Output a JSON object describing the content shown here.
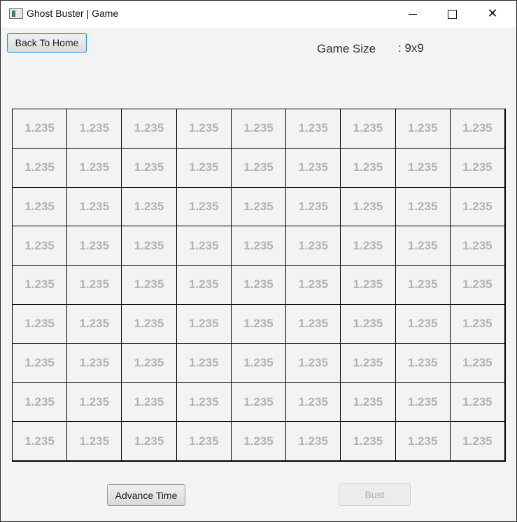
{
  "window": {
    "title": "Ghost Buster | Game",
    "icon": "app-window-icon"
  },
  "controls": {
    "minimize": "minimize-icon",
    "maximize": "maximize-icon",
    "close": "close-icon"
  },
  "header": {
    "back_label": "Back To Home",
    "game_size_label": "Game Size",
    "game_size_value": ": 9x9"
  },
  "board": {
    "rows": 9,
    "cols": 9,
    "cells": [
      [
        "1.235",
        "1.235",
        "1.235",
        "1.235",
        "1.235",
        "1.235",
        "1.235",
        "1.235",
        "1.235"
      ],
      [
        "1.235",
        "1.235",
        "1.235",
        "1.235",
        "1.235",
        "1.235",
        "1.235",
        "1.235",
        "1.235"
      ],
      [
        "1.235",
        "1.235",
        "1.235",
        "1.235",
        "1.235",
        "1.235",
        "1.235",
        "1.235",
        "1.235"
      ],
      [
        "1.235",
        "1.235",
        "1.235",
        "1.235",
        "1.235",
        "1.235",
        "1.235",
        "1.235",
        "1.235"
      ],
      [
        "1.235",
        "1.235",
        "1.235",
        "1.235",
        "1.235",
        "1.235",
        "1.235",
        "1.235",
        "1.235"
      ],
      [
        "1.235",
        "1.235",
        "1.235",
        "1.235",
        "1.235",
        "1.235",
        "1.235",
        "1.235",
        "1.235"
      ],
      [
        "1.235",
        "1.235",
        "1.235",
        "1.235",
        "1.235",
        "1.235",
        "1.235",
        "1.235",
        "1.235"
      ],
      [
        "1.235",
        "1.235",
        "1.235",
        "1.235",
        "1.235",
        "1.235",
        "1.235",
        "1.235",
        "1.235"
      ],
      [
        "1.235",
        "1.235",
        "1.235",
        "1.235",
        "1.235",
        "1.235",
        "1.235",
        "1.235",
        "1.235"
      ]
    ],
    "cell_text_color": "#b3b3b3"
  },
  "footer": {
    "advance_label": "Advance Time",
    "bust_label": "Bust",
    "bust_disabled": true
  }
}
